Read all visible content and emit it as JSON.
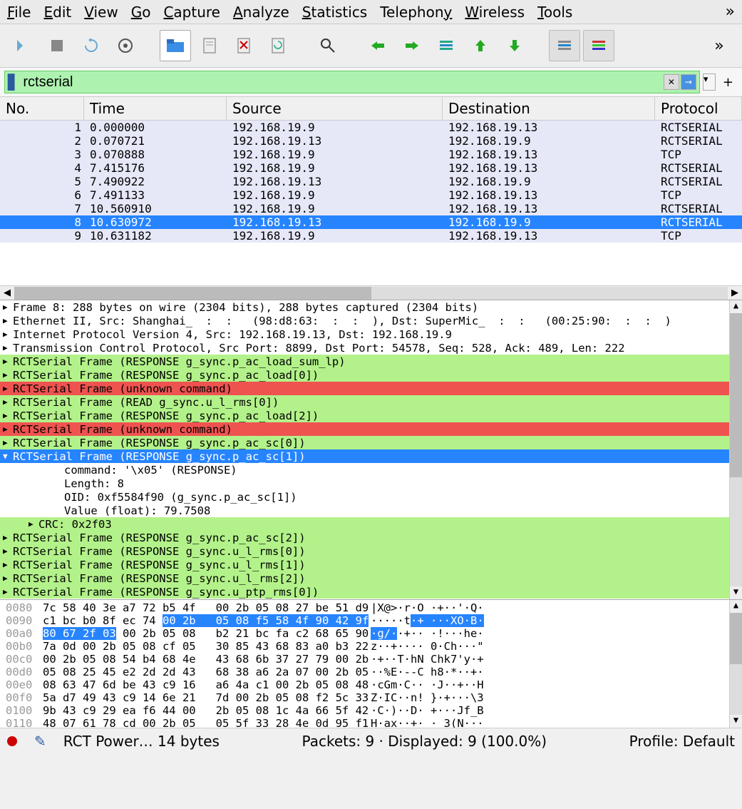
{
  "menu": [
    "File",
    "Edit",
    "View",
    "Go",
    "Capture",
    "Analyze",
    "Statistics",
    "Telephony",
    "Wireless",
    "Tools"
  ],
  "filter": {
    "value": "rctserial"
  },
  "plist": {
    "headers": [
      "No.",
      "Time",
      "Source",
      "Destination",
      "Protocol"
    ],
    "rows": [
      {
        "no": "1",
        "time": "0.000000",
        "src": "192.168.19.9",
        "dst": "192.168.19.13",
        "proto": "RCTSERIAL"
      },
      {
        "no": "2",
        "time": "0.070721",
        "src": "192.168.19.13",
        "dst": "192.168.19.9",
        "proto": "RCTSERIAL"
      },
      {
        "no": "3",
        "time": "0.070888",
        "src": "192.168.19.9",
        "dst": "192.168.19.13",
        "proto": "TCP"
      },
      {
        "no": "4",
        "time": "7.415176",
        "src": "192.168.19.9",
        "dst": "192.168.19.13",
        "proto": "RCTSERIAL"
      },
      {
        "no": "5",
        "time": "7.490922",
        "src": "192.168.19.13",
        "dst": "192.168.19.9",
        "proto": "RCTSERIAL"
      },
      {
        "no": "6",
        "time": "7.491133",
        "src": "192.168.19.9",
        "dst": "192.168.19.13",
        "proto": "TCP"
      },
      {
        "no": "7",
        "time": "10.560910",
        "src": "192.168.19.9",
        "dst": "192.168.19.13",
        "proto": "RCTSERIAL"
      },
      {
        "no": "8",
        "time": "10.630972",
        "src": "192.168.19.13",
        "dst": "192.168.19.9",
        "proto": "RCTSERIAL",
        "selected": true
      },
      {
        "no": "9",
        "time": "10.631182",
        "src": "192.168.19.9",
        "dst": "192.168.19.13",
        "proto": "TCP"
      }
    ]
  },
  "details": [
    {
      "cls": "",
      "txt": "Frame 8: 288 bytes on wire (2304 bits), 288 bytes captured (2304 bits)",
      "exp": "▶"
    },
    {
      "cls": "",
      "txt": "Ethernet II, Src: Shanghai_  :  :   (98:d8:63:  :  :  ), Dst: SuperMic_  :  :   (00:25:90:  :  :  )",
      "exp": "▶"
    },
    {
      "cls": "",
      "txt": "Internet Protocol Version 4, Src: 192.168.19.13, Dst: 192.168.19.9",
      "exp": "▶"
    },
    {
      "cls": "",
      "txt": "Transmission Control Protocol, Src Port: 8899, Dst Port: 54578, Seq: 528, Ack: 489, Len: 222",
      "exp": "▶"
    },
    {
      "cls": "bg-green",
      "txt": "RCTSerial Frame (RESPONSE g_sync.p_ac_load_sum_lp)",
      "exp": "▶"
    },
    {
      "cls": "bg-green",
      "txt": "RCTSerial Frame (RESPONSE g_sync.p_ac_load[0])",
      "exp": "▶"
    },
    {
      "cls": "bg-red",
      "txt": "RCTSerial Frame (unknown command)",
      "exp": "▶"
    },
    {
      "cls": "bg-green",
      "txt": "RCTSerial Frame (READ g_sync.u_l_rms[0])",
      "exp": "▶"
    },
    {
      "cls": "bg-green",
      "txt": "RCTSerial Frame (RESPONSE g_sync.p_ac_load[2])",
      "exp": "▶"
    },
    {
      "cls": "bg-red",
      "txt": "RCTSerial Frame (unknown command)",
      "exp": "▶"
    },
    {
      "cls": "bg-green",
      "txt": "RCTSerial Frame (RESPONSE g_sync.p_ac_sc[0])",
      "exp": "▶"
    },
    {
      "cls": "bg-blue",
      "txt": "RCTSerial Frame (RESPONSE g_sync.p_ac_sc[1])",
      "exp": "▼"
    },
    {
      "cls": "",
      "txt": "command: '\\x05' (RESPONSE)",
      "indent": 2
    },
    {
      "cls": "",
      "txt": "Length: 8",
      "indent": 2
    },
    {
      "cls": "",
      "txt": "OID: 0xf5584f90 (g_sync.p_ac_sc[1])",
      "indent": 2
    },
    {
      "cls": "",
      "txt": "Value (float): 79.7508",
      "indent": 2
    },
    {
      "cls": "bg-green",
      "txt": "CRC: 0x2f03",
      "indent": 1,
      "exp": "▶"
    },
    {
      "cls": "bg-green",
      "txt": "RCTSerial Frame (RESPONSE g_sync.p_ac_sc[2])",
      "exp": "▶"
    },
    {
      "cls": "bg-green",
      "txt": "RCTSerial Frame (RESPONSE g_sync.u_l_rms[0])",
      "exp": "▶"
    },
    {
      "cls": "bg-green",
      "txt": "RCTSerial Frame (RESPONSE g_sync.u_l_rms[1])",
      "exp": "▶"
    },
    {
      "cls": "bg-green",
      "txt": "RCTSerial Frame (RESPONSE g_sync.u_l_rms[2])",
      "exp": "▶"
    },
    {
      "cls": "bg-green",
      "txt": "RCTSerial Frame (RESPONSE g_sync.u_ptp_rms[0])",
      "exp": "▶"
    }
  ],
  "hex": [
    {
      "off": "0080",
      "bytes": "7c 58 40 3e a7 72 b5 4f   00 2b 05 08 27 be 51 d9",
      "ascii": "|X@>·r·O ·+··'·Q·"
    },
    {
      "off": "0090",
      "bytes": "c1 bc b0 8f ec 74 ",
      "sel": "00 2b   05 08 f5 58 4f 90 42 9f",
      "ascii": "·····t·+ ···XO·B·",
      "asciisel": [
        6,
        17
      ]
    },
    {
      "off": "00a0",
      "sel": "80 67 2f 03",
      "bytes2": " 00 2b 05 08   b2 21 bc fa c2 68 65 90",
      "ascii": "·g/··+·· ·!···he·",
      "asciisel": [
        0,
        4
      ]
    },
    {
      "off": "00b0",
      "bytes": "7a 0d 00 2b 05 08 cf 05   30 85 43 68 83 a0 b3 22",
      "ascii": "z··+···· 0·Ch···\""
    },
    {
      "off": "00c0",
      "bytes": "00 2b 05 08 54 b4 68 4e   43 68 6b 37 27 79 00 2b",
      "ascii": "·+··T·hN Chk7'y·+"
    },
    {
      "off": "00d0",
      "bytes": "05 08 25 45 e2 2d 2d 43   68 38 a6 2a 07 00 2b 05",
      "ascii": "··%E·--C h8·*··+·"
    },
    {
      "off": "00e0",
      "bytes": "08 63 47 6d be 43 c9 16   a6 4a c1 00 2b 05 08 48",
      "ascii": "·cGm·C·· ·J··+··H"
    },
    {
      "off": "00f0",
      "bytes": "5a d7 49 43 c9 14 6e 21   7d 00 2b 05 08 f2 5c 33",
      "ascii": "Z·IC··n! }·+···\\3"
    },
    {
      "off": "0100",
      "bytes": "9b 43 c9 29 ea f6 44 00   2b 05 08 1c 4a 66 5f 42",
      "ascii": "·C·)··D· +···Jf_B"
    },
    {
      "off": "0110",
      "bytes": "48 07 61 78 cd 00 2b 05   05 5f 33 28 4e 0d 95 f1",
      "ascii": "H·ax··+· ·_3(N···"
    }
  ],
  "status": {
    "left": "RCT Power… 14 bytes",
    "center": "Packets: 9 · Displayed: 9 (100.0%)",
    "right": "Profile: Default"
  }
}
